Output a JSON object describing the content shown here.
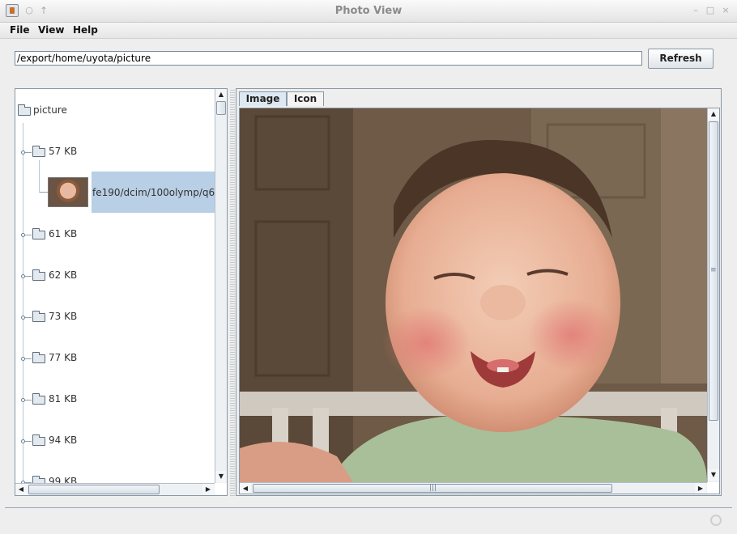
{
  "window": {
    "title": "Photo View"
  },
  "icons": {
    "app": "java-cup-icon",
    "pin": "pin-icon",
    "up": "arrow-up-icon",
    "minimize": "minimize-icon",
    "maximize": "maximize-icon",
    "close": "close-icon",
    "folder": "folder-icon",
    "status": "busy-spinner-icon"
  },
  "menu": [
    "File",
    "View",
    "Help"
  ],
  "toolbar": {
    "path_value": "/export/home/uyota/picture",
    "refresh_label": "Refresh"
  },
  "tree": {
    "root": "picture",
    "nodes": [
      {
        "label": "57 KB",
        "expanded": true
      },
      {
        "label": "61 KB"
      },
      {
        "label": "62 KB"
      },
      {
        "label": "73 KB"
      },
      {
        "label": "77 KB"
      },
      {
        "label": "81 KB"
      },
      {
        "label": "94 KB"
      },
      {
        "label": "99 KB"
      }
    ],
    "selected_file": "fe190/dcim/100olymp/q6"
  },
  "tabs": [
    {
      "label": "Image",
      "active": true
    },
    {
      "label": "Icon",
      "active": false
    }
  ],
  "colors": {
    "selection": "#b8cfe5",
    "border": "#8a98a6",
    "window_bg": "#eeeeee"
  }
}
